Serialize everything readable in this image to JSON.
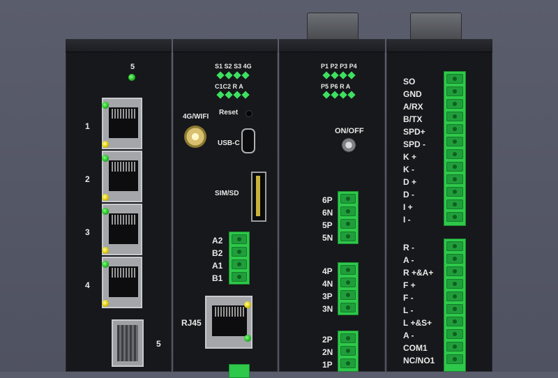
{
  "module1": {
    "top_led_label": "5",
    "ports": [
      "1",
      "2",
      "3",
      "4"
    ],
    "sfp_label": "5"
  },
  "module2": {
    "status_leds_row1": [
      "S1",
      "S2",
      "S3",
      "4G"
    ],
    "status_leds_row2": [
      "C1",
      "C2",
      "R",
      "A"
    ],
    "antenna_label": "4G/WIFI",
    "reset_label": "Reset",
    "usb_label": "USB-C",
    "sim_label": "SIM/SD",
    "terminal_labels": [
      "A2",
      "B2",
      "A1",
      "B1"
    ],
    "rj45_label": "RJ45"
  },
  "module3": {
    "leds_row1": [
      "P1",
      "P2",
      "P3",
      "P4"
    ],
    "leds_row2": [
      "P5",
      "P6",
      "R",
      "A"
    ],
    "onoff_label": "ON/OFF",
    "terminal_group1": [
      "6P",
      "6N",
      "5P",
      "5N"
    ],
    "terminal_group2": [
      "4P",
      "4N",
      "3P",
      "3N"
    ],
    "terminal_group3": [
      "2P",
      "2N",
      "1P"
    ]
  },
  "module4": {
    "terminal_group1": [
      "SO",
      "GND",
      "A/RX",
      "B/TX",
      "SPD+",
      "SPD -",
      "K +",
      "K -",
      "D +",
      "D -",
      "I  +",
      "I  -"
    ],
    "terminal_group2": [
      "R -",
      "A -",
      "R +&A+",
      "F +",
      "F -",
      "L -",
      "L +&S+",
      "A -",
      "COM1",
      "NC/NO1"
    ]
  },
  "colors": {
    "background": "#55586a",
    "module": "#17181b",
    "terminal_green": "#2ec84a",
    "led_green": "#3ee060"
  }
}
